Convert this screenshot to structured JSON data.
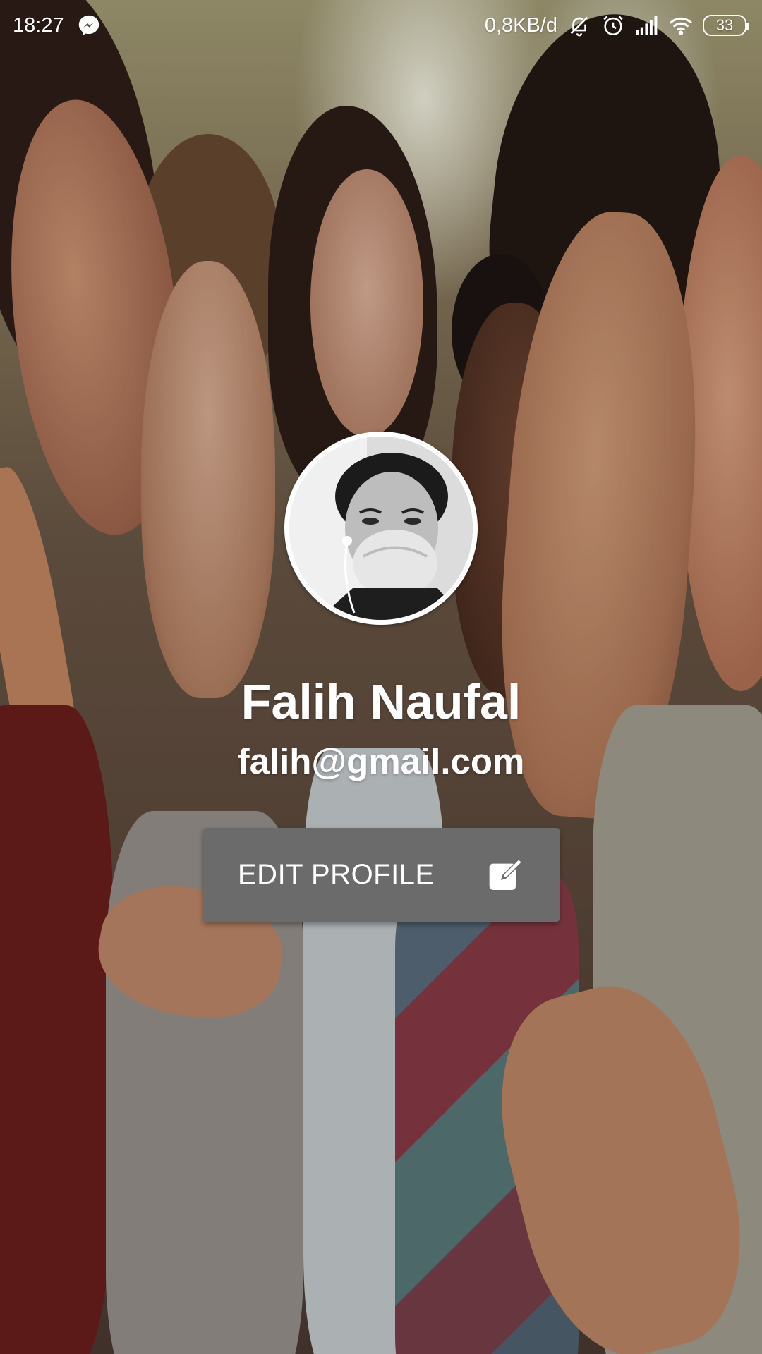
{
  "status_bar": {
    "time": "18:27",
    "network_speed": "0,8KB/d",
    "battery_level": "33",
    "icons": [
      "messenger-icon",
      "notifications-off-icon",
      "alarm-icon",
      "signal-icon",
      "wifi-icon",
      "battery-icon"
    ]
  },
  "profile": {
    "name": "Falih Naufal",
    "email": "falih@gmail.com",
    "edit_button_label": "EDIT PROFILE",
    "edit_icon": "edit-icon"
  },
  "colors": {
    "button_bg": "#6b6b6b",
    "text": "#ffffff",
    "avatar_ring": "#ffffff"
  }
}
